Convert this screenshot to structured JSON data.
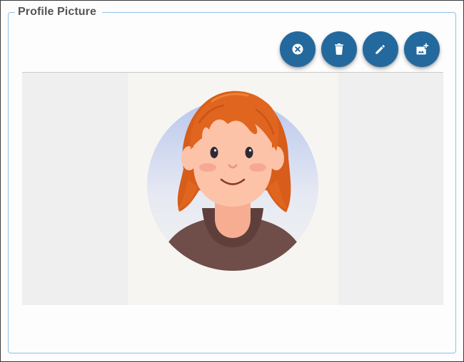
{
  "panel": {
    "legend": "Profile Picture"
  },
  "toolbar": {
    "buttons": [
      {
        "name": "clear-button",
        "icon": "cancel-circle-icon"
      },
      {
        "name": "delete-button",
        "icon": "trash-icon"
      },
      {
        "name": "edit-button",
        "icon": "pencil-icon"
      },
      {
        "name": "add-photo-button",
        "icon": "add-photo-icon"
      }
    ],
    "button_color": "#23699d",
    "icon_color": "#ffffff"
  },
  "preview": {
    "image": "avatar-illustration",
    "image_description_colors": {
      "hair": "#e0651f",
      "shirt": "#6f4d49",
      "skin": "#fcc3a8",
      "halo_top": "#b8c7ec"
    }
  }
}
